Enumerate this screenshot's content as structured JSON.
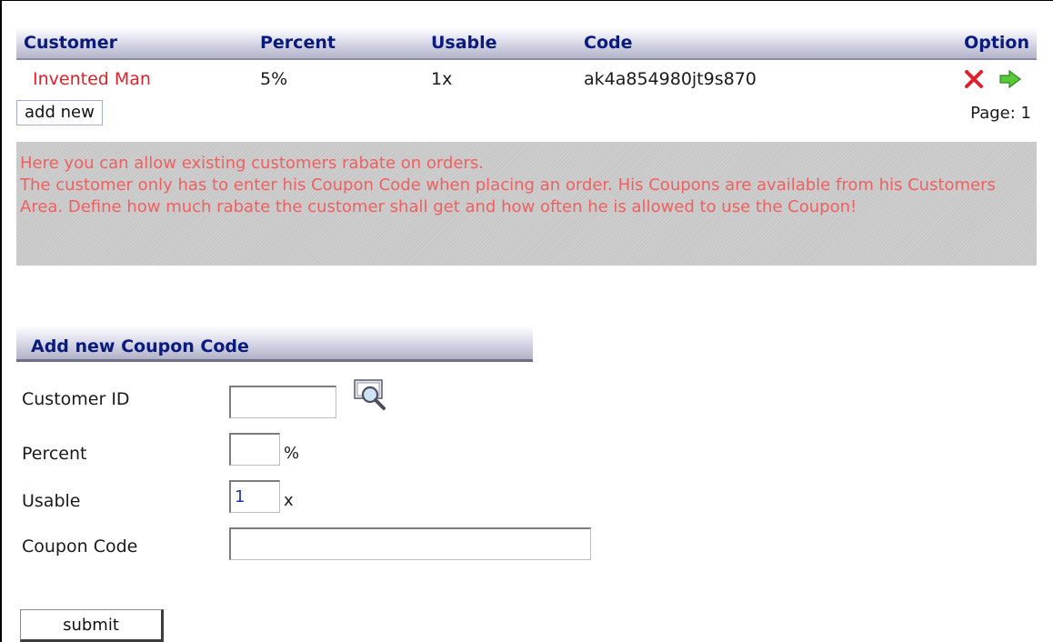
{
  "table": {
    "headers": {
      "customer": "Customer",
      "percent": "Percent",
      "usable": "Usable",
      "code": "Code",
      "option": "Option"
    },
    "rows": [
      {
        "customer": "Invented Man",
        "percent": "5%",
        "usable": "1x",
        "code": "ak4a854980jt9s870",
        "actions": [
          "delete-icon",
          "edit-arrow-icon"
        ]
      }
    ]
  },
  "add_new_label": "add new",
  "pager_text": "Page: 1",
  "info": {
    "line1": "Here you can allow existing customers rabate on orders.",
    "line2": "The customer only has to enter his Coupon Code when placing an order. His Coupons are available from his Customers Area. Define how much rabate the customer shall get and how often he is allowed to use the Coupon!"
  },
  "form": {
    "title": "Add new Coupon Code",
    "customer_id_label": "Customer ID",
    "customer_id_value": "",
    "percent_label": "Percent",
    "percent_value": "",
    "percent_suffix": "%",
    "usable_label": "Usable",
    "usable_value": "1",
    "usable_suffix": "x",
    "coupon_code_label": "Coupon Code",
    "coupon_code_value": "",
    "submit_label": "submit"
  },
  "colors": {
    "header_text": "#0a1b7e",
    "customer_link": "#e0202a",
    "info_text": "#f06060",
    "info_bg": "#c7c7c7",
    "delete_icon": "#e0202a",
    "arrow_icon": "#58c93a"
  }
}
